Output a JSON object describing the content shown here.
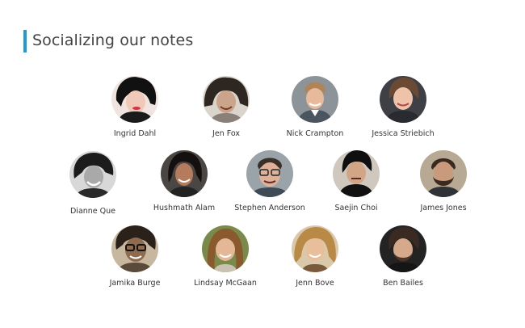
{
  "slide": {
    "title": "Socializing our notes",
    "accent_color": "#1f9ad6"
  },
  "people": [
    {
      "name": "Ingrid Dahl",
      "icon": "person-photo-icon"
    },
    {
      "name": "Jen Fox",
      "icon": "person-photo-icon"
    },
    {
      "name": "Nick Crampton",
      "icon": "person-photo-icon"
    },
    {
      "name": "Jessica Striebich",
      "icon": "person-photo-icon"
    },
    {
      "name": "Dianne Que",
      "icon": "person-photo-icon"
    },
    {
      "name": "Hushmath Alam",
      "icon": "person-photo-icon"
    },
    {
      "name": "Stephen Anderson",
      "icon": "person-photo-icon"
    },
    {
      "name": "Saejin Choi",
      "icon": "person-photo-icon"
    },
    {
      "name": "James Jones",
      "icon": "person-photo-icon"
    },
    {
      "name": "Jamika Burge",
      "icon": "person-photo-icon"
    },
    {
      "name": "Lindsay McGaan",
      "icon": "person-photo-icon"
    },
    {
      "name": "Jenn Bove",
      "icon": "person-photo-icon"
    },
    {
      "name": "Ben Bailes",
      "icon": "person-photo-icon"
    }
  ]
}
